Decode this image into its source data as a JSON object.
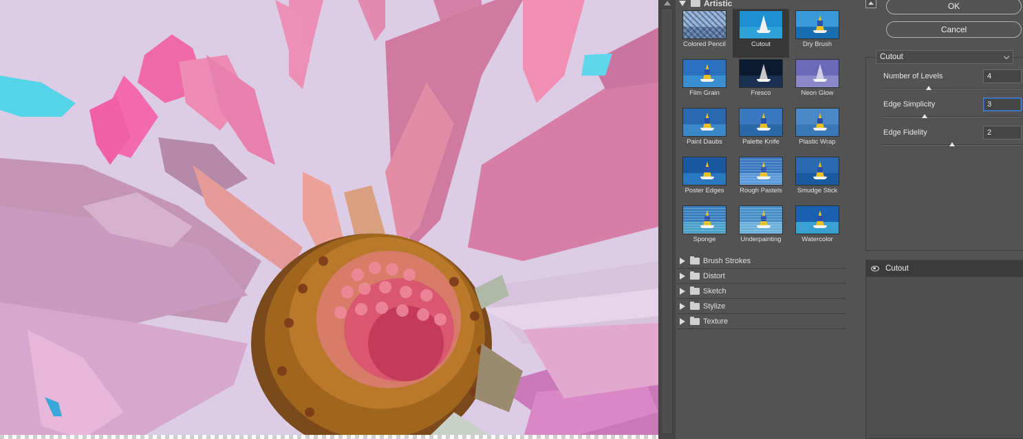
{
  "gallery": {
    "artistic": {
      "label": "Artistic",
      "filters": [
        {
          "label": "Colored Pencil",
          "sky": "#8fb3d8",
          "sea": "#5a7ca8",
          "style": "pencil"
        },
        {
          "label": "Cutout",
          "sky": "#1d8fd0",
          "sea": "#2fa3d8",
          "style": "cutout",
          "selected": true
        },
        {
          "label": "Dry Brush",
          "sky": "#3a9ad8",
          "sea": "#1a6fb0",
          "style": "boat"
        },
        {
          "label": "Film Grain",
          "sky": "#2a72c0",
          "sea": "#3a8fd0",
          "style": "boat"
        },
        {
          "label": "Fresco",
          "sky": "#0c1a30",
          "sea": "#1a3050",
          "style": "dark"
        },
        {
          "label": "Neon Glow",
          "sky": "#6a68b8",
          "sea": "#8a88c8",
          "style": "neon"
        },
        {
          "label": "Paint Daubs",
          "sky": "#2a68b0",
          "sea": "#3a88c8",
          "style": "boat"
        },
        {
          "label": "Palette Knife",
          "sky": "#3a78c0",
          "sea": "#2a68a8",
          "style": "boat"
        },
        {
          "label": "Plastic Wrap",
          "sky": "#4a88c8",
          "sea": "#3a78b8",
          "style": "boat"
        },
        {
          "label": "Poster Edges",
          "sky": "#1a58a0",
          "sea": "#2a78c0",
          "style": "boat"
        },
        {
          "label": "Rough Pastels",
          "sky": "#3a78c0",
          "sea": "#5a98d8",
          "style": "pastel"
        },
        {
          "label": "Smudge Stick",
          "sky": "#2a6ab0",
          "sea": "#1a5aa0",
          "style": "boat"
        },
        {
          "label": "Sponge",
          "sky": "#3a80c0",
          "sea": "#4aa0c8",
          "style": "sponge"
        },
        {
          "label": "Underpainting",
          "sky": "#4a90c8",
          "sea": "#6ab0d8",
          "style": "pastel"
        },
        {
          "label": "Watercolor",
          "sky": "#1a60b0",
          "sea": "#3aa0d0",
          "style": "water"
        }
      ]
    },
    "categories": [
      "Brush Strokes",
      "Distort",
      "Sketch",
      "Stylize",
      "Texture"
    ]
  },
  "buttons": {
    "ok": "OK",
    "cancel": "Cancel"
  },
  "filter_select": {
    "value": "Cutout"
  },
  "params": [
    {
      "label": "Number of Levels",
      "value": "4",
      "min": 2,
      "max": 8
    },
    {
      "label": "Edge Simplicity",
      "value": "3",
      "min": 0,
      "max": 10,
      "focused": true
    },
    {
      "label": "Edge Fidelity",
      "value": "2",
      "min": 1,
      "max": 3
    }
  ],
  "layers": {
    "active": "Cutout"
  },
  "colors": {
    "panel": "#535353",
    "preview_bg": "#dccce6",
    "focus": "#4d88e0"
  }
}
